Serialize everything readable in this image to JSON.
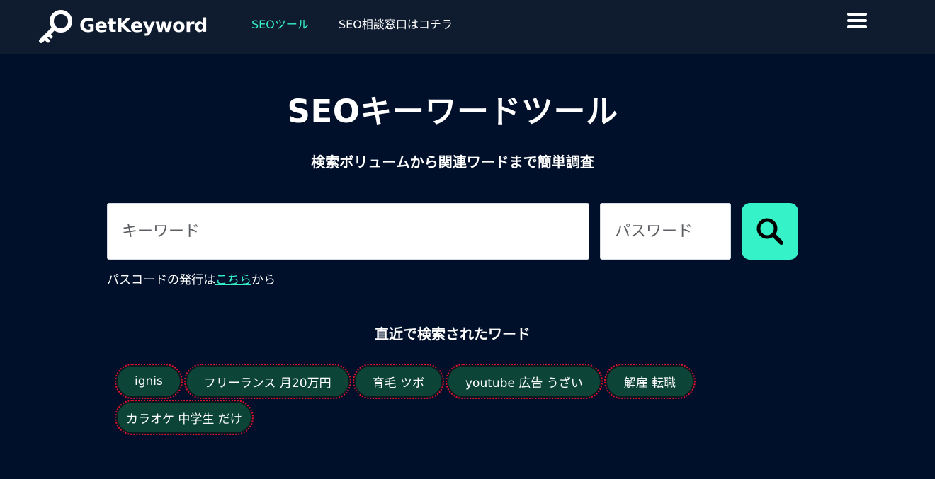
{
  "header": {
    "logo_text": "GetKeyword",
    "nav": [
      {
        "label": "SEOツール",
        "active": true
      },
      {
        "label": "SEO相談窓口はコチラ",
        "active": false
      }
    ],
    "menu_icon": "hamburger-menu-icon"
  },
  "hero": {
    "title": "SEOキーワードツール",
    "subtitle": "検索ボリュームから関連ワードまで簡単調査"
  },
  "search": {
    "keyword_placeholder": "キーワード",
    "password_placeholder": "パスワード",
    "button_icon": "search-icon",
    "note_prefix": "パスコードの発行は",
    "note_link": "こちら",
    "note_suffix": "から"
  },
  "recent": {
    "title": "直近で検索されたワード",
    "tags": [
      "ignis",
      "フリーランス 月20万円",
      "育毛 ツボ",
      "youtube 広告 うざい",
      "解雇 転職",
      "カラオケ 中学生 だけ"
    ]
  },
  "colors": {
    "page_background": "#00102a",
    "header_background": "#0f1b2f",
    "accent": "#36f2c9",
    "tag_background": "#0c4537",
    "tag_outline": "#e2122a"
  }
}
